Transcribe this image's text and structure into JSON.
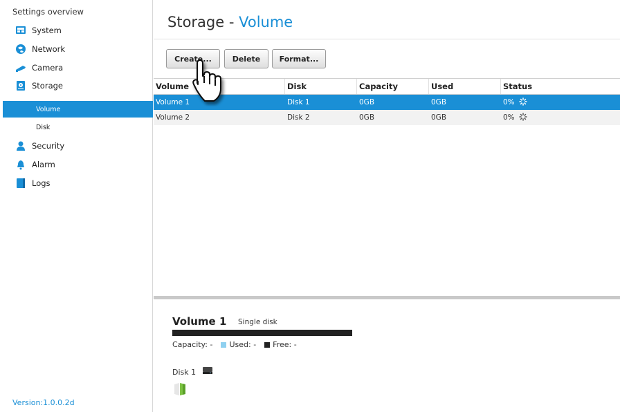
{
  "sidebar": {
    "title": "Settings overview",
    "items": [
      {
        "label": "System",
        "icon": "system-icon"
      },
      {
        "label": "Network",
        "icon": "network-icon"
      },
      {
        "label": "Camera",
        "icon": "camera-icon"
      },
      {
        "label": "Storage",
        "icon": "storage-icon"
      }
    ],
    "sub_items": [
      {
        "label": "Volume",
        "active": true
      },
      {
        "label": "Disk",
        "active": false
      }
    ],
    "items_after": [
      {
        "label": "Security",
        "icon": "security-icon"
      },
      {
        "label": "Alarm",
        "icon": "alarm-icon"
      },
      {
        "label": "Logs",
        "icon": "logs-icon"
      }
    ],
    "version": "Version:1.0.0.2d"
  },
  "header": {
    "title": "Storage",
    "separator": "-",
    "subtitle": "Volume"
  },
  "toolbar": {
    "create_label": "Create...",
    "delete_label": "Delete",
    "format_label": "Format..."
  },
  "table": {
    "columns": [
      "Volume",
      "Disk",
      "Capacity",
      "Used",
      "Status"
    ],
    "rows": [
      {
        "volume": "Volume 1",
        "disk": "Disk 1",
        "capacity": "0GB",
        "used": "0GB",
        "status": "0%"
      },
      {
        "volume": "Volume 2",
        "disk": "Disk 2",
        "capacity": "0GB",
        "used": "0GB",
        "status": "0%"
      }
    ]
  },
  "detail": {
    "title": "Volume 1",
    "subtitle": "Single disk",
    "capacity_label": "Capacity: -",
    "used_label": "Used: -",
    "free_label": "Free: -",
    "disk_label": "Disk 1"
  },
  "colors": {
    "accent": "#1a8fd6",
    "used": "#8fd0f0",
    "free": "#222222"
  }
}
